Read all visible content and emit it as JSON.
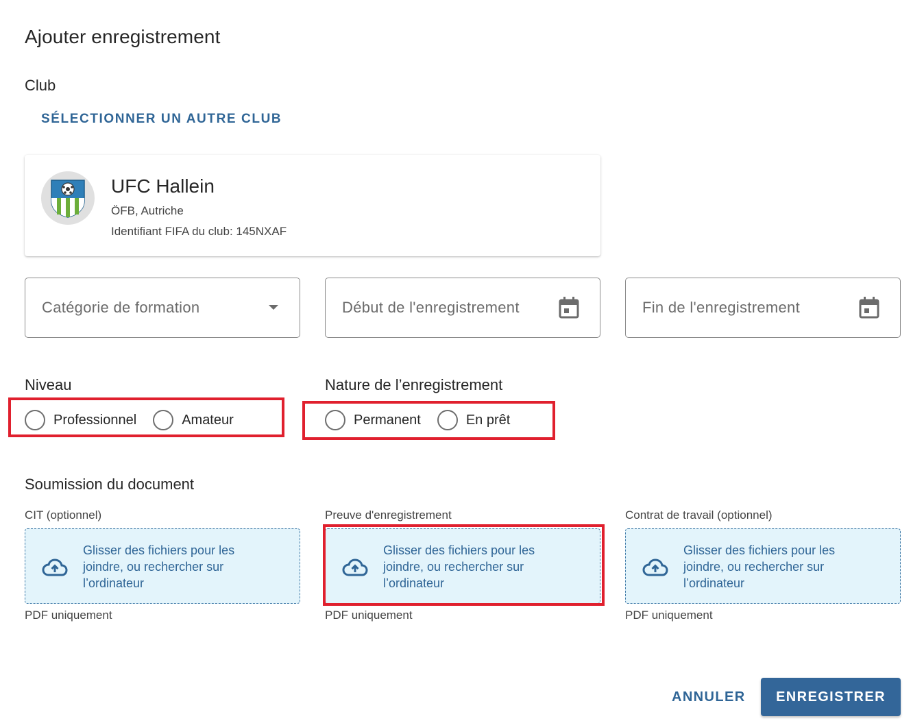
{
  "dialog": {
    "title": "Ajouter enregistrement"
  },
  "club_section": {
    "label": "Club",
    "select_other_label": "SÉLECTIONNER UN AUTRE CLUB",
    "card": {
      "name": "UFC Hallein",
      "association": "ÖFB, Autriche",
      "fifa_id": "Identifiant FIFA du club: 145NXAF",
      "logo_icon": "club-crest"
    }
  },
  "fields": {
    "category": {
      "placeholder": "Catégorie de formation",
      "icon": "dropdown-arrow"
    },
    "start": {
      "placeholder": "Début de l'enregistrement",
      "icon": "calendar-icon"
    },
    "end": {
      "placeholder": "Fin de l'enregistrement",
      "icon": "calendar-icon"
    }
  },
  "niveau": {
    "label": "Niveau",
    "options": [
      "Professionnel",
      "Amateur"
    ]
  },
  "nature": {
    "label": "Nature de l’enregistrement",
    "options": [
      "Permanent",
      "En prêt"
    ]
  },
  "documents": {
    "label": "Soumission du document",
    "uploads": [
      {
        "caption": "CIT (optionnel)",
        "drop_text": "Glisser des fichiers pour les joindre, ou rechercher sur l’ordinateur",
        "hint": "PDF uniquement"
      },
      {
        "caption": "Preuve d'enregistrement",
        "drop_text": "Glisser des fichiers pour les joindre, ou rechercher sur l’ordinateur",
        "hint": "PDF uniquement"
      },
      {
        "caption": "Contrat de travail (optionnel)",
        "drop_text": "Glisser des fichiers pour les joindre, ou rechercher sur l’ordinateur",
        "hint": "PDF uniquement"
      }
    ]
  },
  "actions": {
    "cancel": "ANNULER",
    "save": "ENREGISTRER"
  },
  "colors": {
    "accent": "#336699",
    "link": "#2f6596",
    "highlight": "#e0202e",
    "dropzone_bg": "#e3f4fb"
  }
}
